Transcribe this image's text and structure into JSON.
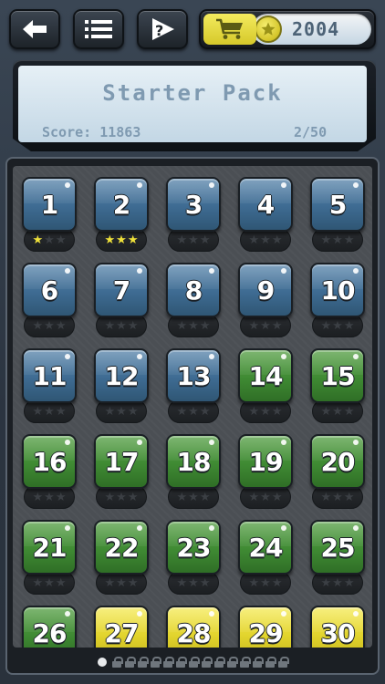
{
  "topbar": {
    "back_icon": "back-arrow-icon",
    "menu_icon": "list-menu-icon",
    "help_icon": "help-question-icon",
    "cart_icon": "shopping-cart-icon",
    "coin_icon": "star-coin-icon",
    "coins": "2004"
  },
  "pack": {
    "title": "Starter Pack",
    "score_label": "Score:",
    "score_value": "11863",
    "progress": "2/50"
  },
  "colors": {
    "blue": "#3e6b92",
    "green": "#3f8a33",
    "yellow": "#e2d42d",
    "star_on": "#f0e23a"
  },
  "levels": [
    {
      "num": "1",
      "color": "blue",
      "stars": 1
    },
    {
      "num": "2",
      "color": "blue",
      "stars": 3
    },
    {
      "num": "3",
      "color": "blue",
      "stars": 0
    },
    {
      "num": "4",
      "color": "blue",
      "stars": 0
    },
    {
      "num": "5",
      "color": "blue",
      "stars": 0
    },
    {
      "num": "6",
      "color": "blue",
      "stars": 0
    },
    {
      "num": "7",
      "color": "blue",
      "stars": 0
    },
    {
      "num": "8",
      "color": "blue",
      "stars": 0
    },
    {
      "num": "9",
      "color": "blue",
      "stars": 0
    },
    {
      "num": "10",
      "color": "blue",
      "stars": 0
    },
    {
      "num": "11",
      "color": "blue",
      "stars": 0
    },
    {
      "num": "12",
      "color": "blue",
      "stars": 0
    },
    {
      "num": "13",
      "color": "blue",
      "stars": 0
    },
    {
      "num": "14",
      "color": "green",
      "stars": 0
    },
    {
      "num": "15",
      "color": "green",
      "stars": 0
    },
    {
      "num": "16",
      "color": "green",
      "stars": 0
    },
    {
      "num": "17",
      "color": "green",
      "stars": 0
    },
    {
      "num": "18",
      "color": "green",
      "stars": 0
    },
    {
      "num": "19",
      "color": "green",
      "stars": 0
    },
    {
      "num": "20",
      "color": "green",
      "stars": 0
    },
    {
      "num": "21",
      "color": "green",
      "stars": 0
    },
    {
      "num": "22",
      "color": "green",
      "stars": 0
    },
    {
      "num": "23",
      "color": "green",
      "stars": 0
    },
    {
      "num": "24",
      "color": "green",
      "stars": 0
    },
    {
      "num": "25",
      "color": "green",
      "stars": 0
    },
    {
      "num": "26",
      "color": "green",
      "stars": 0
    },
    {
      "num": "27",
      "color": "yellow",
      "stars": 0
    },
    {
      "num": "28",
      "color": "yellow",
      "stars": 0
    },
    {
      "num": "29",
      "color": "yellow",
      "stars": 0
    },
    {
      "num": "30",
      "color": "yellow",
      "stars": 0
    }
  ],
  "pager": {
    "current_page": 1,
    "locked_pages": 14
  }
}
